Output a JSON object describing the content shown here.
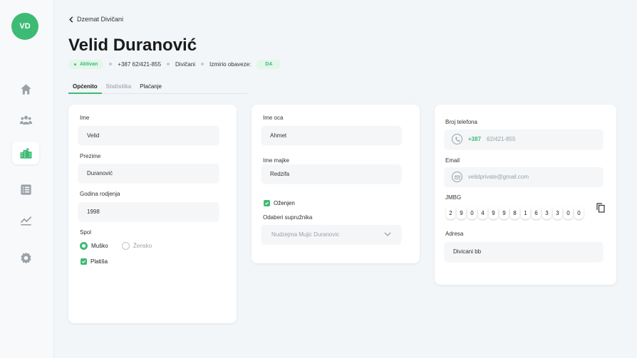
{
  "user": {
    "initials": "VD"
  },
  "sidebar": {
    "items": [
      {
        "icon": "home-icon"
      },
      {
        "icon": "users-icon"
      },
      {
        "icon": "city-icon",
        "active": true
      },
      {
        "icon": "list-icon"
      },
      {
        "icon": "chart-icon"
      },
      {
        "icon": "gear-icon"
      }
    ]
  },
  "header": {
    "back_label": "Dzemat Divičani",
    "title": "Velid Duranović",
    "status": "Aktivan",
    "phone": "+387 62/421-855",
    "place": "Divičani",
    "obligations_label": "Izmirio obaveze:",
    "obligations_value": "DA"
  },
  "tabs": [
    "Općenito",
    "Statistika",
    "Plaćanje"
  ],
  "card1": {
    "first_name_label": "Ime",
    "first_name": "Velid",
    "last_name_label": "Prezime",
    "last_name": "Duranović",
    "birth_year_label": "Godina rodjenja",
    "birth_year": "1998",
    "gender_label": "Spol",
    "gender_male": "Muško",
    "gender_female": "Žensko",
    "payer_label": "Platiša"
  },
  "card2": {
    "father_label": "Ime oca",
    "father": "Ahmet",
    "mother_label": "Ime majke",
    "mother": "Redzifa",
    "married_label": "Oženjen",
    "spouse_label": "Odaberi supružnika",
    "spouse": "Nudzejma Mujic Duranovic"
  },
  "card3": {
    "phone_label": "Broj telefona",
    "phone_prefix": "+387",
    "phone": "62/421-855",
    "email_label": "Email",
    "email": "velidprivate@gmail.com",
    "jmbg_label": "JMBG",
    "jmbg": [
      "2",
      "9",
      "0",
      "4",
      "9",
      "9",
      "8",
      "1",
      "6",
      "3",
      "3",
      "0",
      "0"
    ],
    "address_label": "Adresa",
    "address": "Divicani bb"
  },
  "colors": {
    "accent": "#3dbb74",
    "background": "#f3f6f9"
  }
}
